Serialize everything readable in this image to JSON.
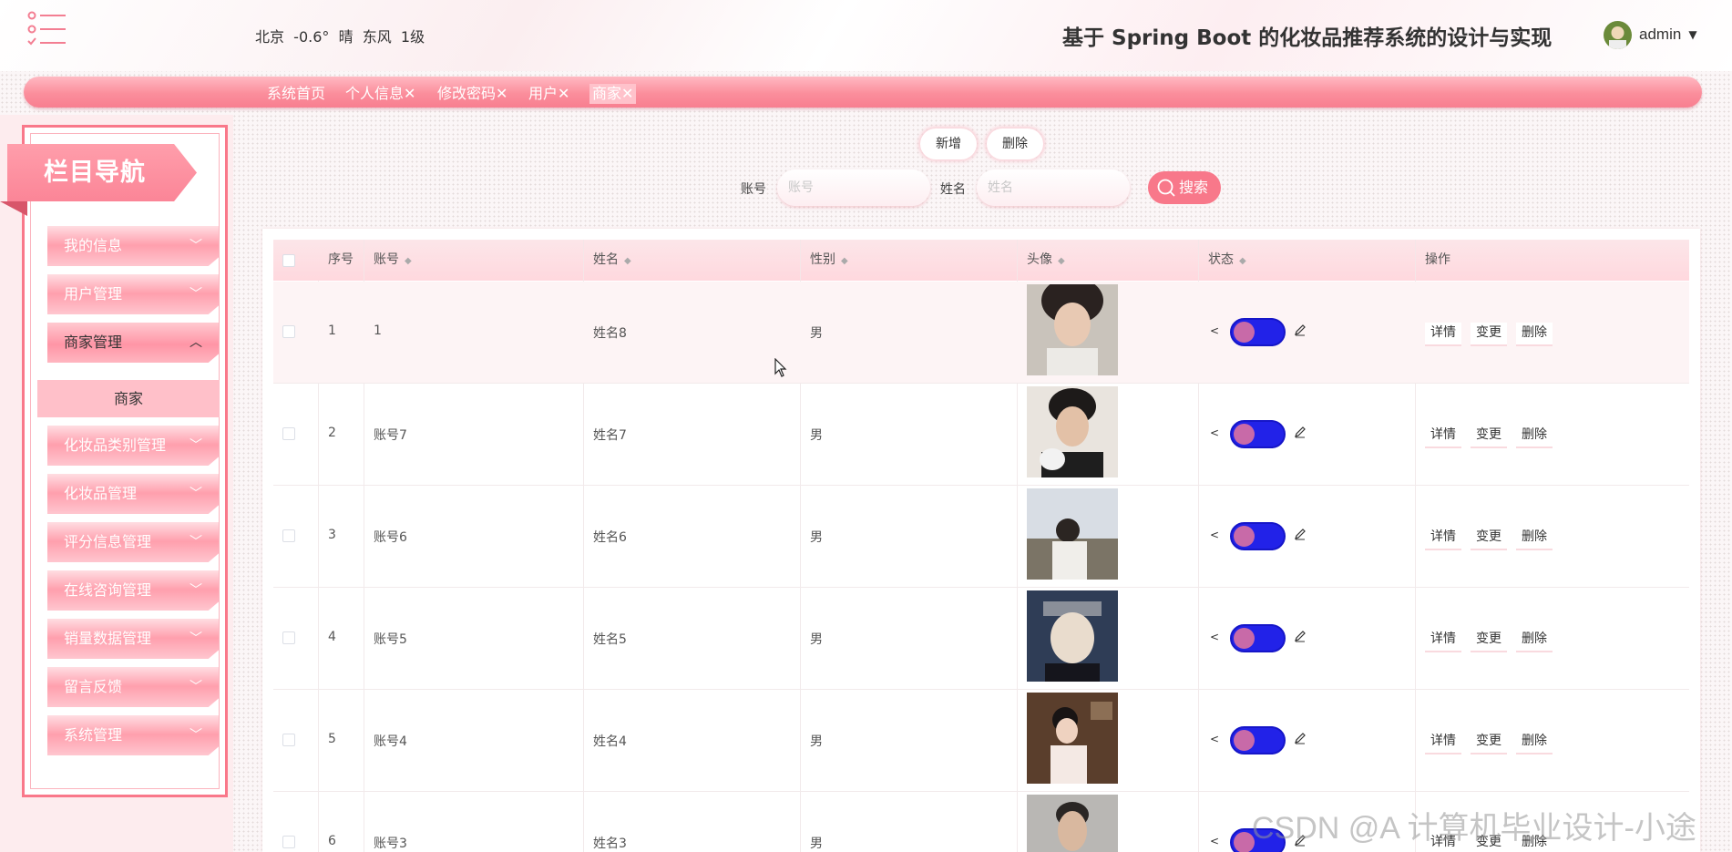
{
  "header": {
    "weather": "北京  -0.6°  晴  东风  1级",
    "title": "基于 Spring Boot 的化妆品推荐系统的设计与实现",
    "username": "admin"
  },
  "tabs": [
    {
      "label": "系统首页"
    },
    {
      "label": "个人信息✕"
    },
    {
      "label": "修改密码✕"
    },
    {
      "label": "用户✕"
    },
    {
      "label": "商家✕"
    }
  ],
  "sidebar": {
    "title": "栏目导航",
    "items": [
      {
        "label": "我的信息"
      },
      {
        "label": "用户管理"
      },
      {
        "label": "商家管理"
      },
      {
        "label": "化妆品类别管理"
      },
      {
        "label": "化妆品管理"
      },
      {
        "label": "评分信息管理"
      },
      {
        "label": "在线咨询管理"
      },
      {
        "label": "销量数据管理"
      },
      {
        "label": "留言反馈"
      },
      {
        "label": "系统管理"
      }
    ],
    "sub_item": "商家"
  },
  "actions": {
    "add": "新增",
    "delete": "删除"
  },
  "search": {
    "account_label": "账号",
    "account_placeholder": "账号",
    "name_label": "姓名",
    "name_placeholder": "姓名",
    "button": "搜索"
  },
  "table": {
    "headers": {
      "index": "序号",
      "account": "账号",
      "name": "姓名",
      "gender": "性别",
      "avatar": "头像",
      "status": "状态",
      "ops": "操作"
    },
    "rows": [
      {
        "index": "1",
        "account": "1",
        "name": "姓名8",
        "gender": "男",
        "status_on": true
      },
      {
        "index": "2",
        "account": "账号7",
        "name": "姓名7",
        "gender": "男",
        "status_on": true
      },
      {
        "index": "3",
        "account": "账号6",
        "name": "姓名6",
        "gender": "男",
        "status_on": true
      },
      {
        "index": "4",
        "account": "账号5",
        "name": "姓名5",
        "gender": "男",
        "status_on": true
      },
      {
        "index": "5",
        "account": "账号4",
        "name": "姓名4",
        "gender": "男",
        "status_on": true
      },
      {
        "index": "6",
        "account": "账号3",
        "name": "姓名3",
        "gender": "男",
        "status_on": true
      }
    ],
    "ops": {
      "detail": "详情",
      "edit": "变更",
      "delete": "删除"
    }
  },
  "watermark": "CSDN @A 计算机毕业设计-小途",
  "colors": {
    "accent": "#f8788a",
    "switch": "#2222e8"
  }
}
